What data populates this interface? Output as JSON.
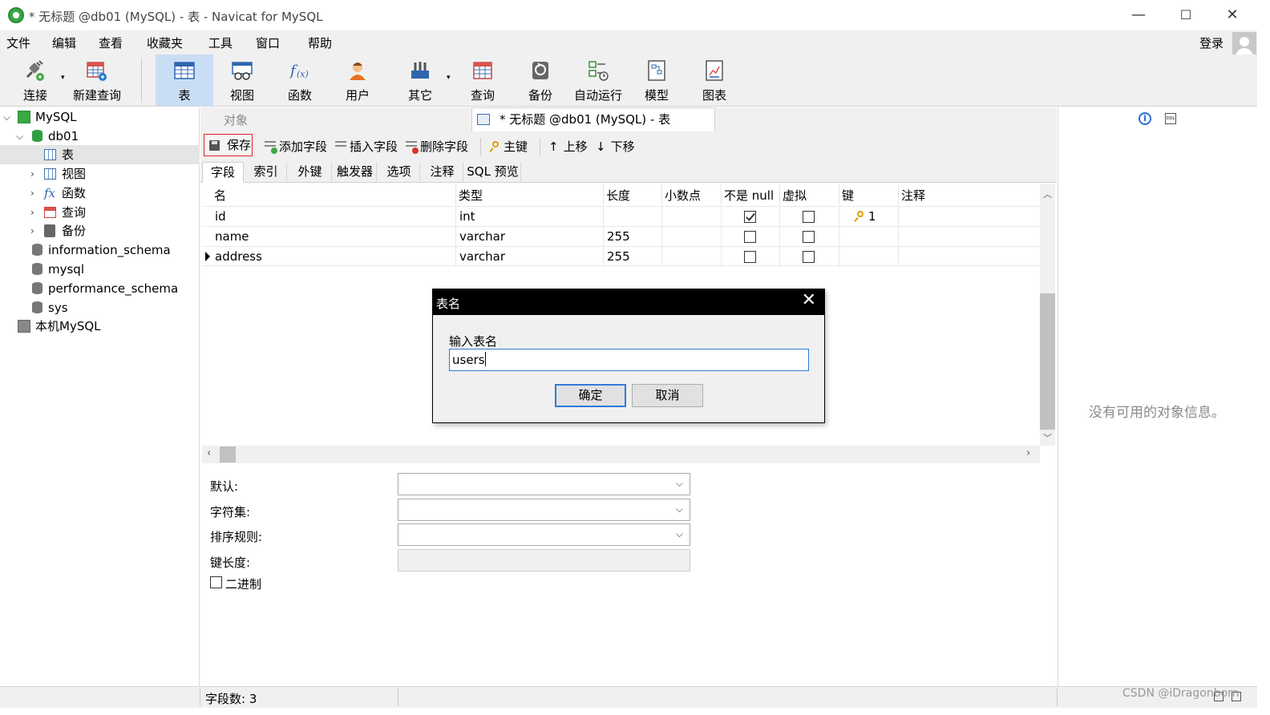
{
  "window": {
    "title": "* 无标题 @db01 (MySQL) - 表 - Navicat for MySQL",
    "controls": [
      "—",
      "☐",
      "✕"
    ]
  },
  "menu": [
    "文件",
    "编辑",
    "查看",
    "收藏夹",
    "工具",
    "窗口",
    "帮助"
  ],
  "login_label": "登录",
  "toolbar": [
    {
      "label": "连接",
      "icon": "plug-icon"
    },
    {
      "label": "新建查询",
      "icon": "new-query-icon"
    },
    {
      "label": "表",
      "icon": "table-icon"
    },
    {
      "label": "视图",
      "icon": "view-icon"
    },
    {
      "label": "函数",
      "icon": "function-icon"
    },
    {
      "label": "用户",
      "icon": "user-icon"
    },
    {
      "label": "其它",
      "icon": "tools-icon"
    },
    {
      "label": "查询",
      "icon": "query-icon"
    },
    {
      "label": "备份",
      "icon": "backup-icon"
    },
    {
      "label": "自动运行",
      "icon": "automation-icon"
    },
    {
      "label": "模型",
      "icon": "model-icon"
    },
    {
      "label": "图表",
      "icon": "chart-icon"
    }
  ],
  "tree": {
    "connection": "MySQL",
    "database": "db01",
    "db_children": [
      "表",
      "视图",
      "函数",
      "查询",
      "备份"
    ],
    "other_dbs": [
      "information_schema",
      "mysql",
      "performance_schema",
      "sys"
    ],
    "local_connection": "本机MySQL"
  },
  "tabs": {
    "objects": "对象",
    "active": "* 无标题 @db01 (MySQL) - 表"
  },
  "editor_toolbar": {
    "save": "保存",
    "add_field": "添加字段",
    "insert_field": "插入字段",
    "delete_field": "删除字段",
    "primary_key": "主键",
    "move_up": "上移",
    "move_down": "下移"
  },
  "subtabs": [
    "字段",
    "索引",
    "外键",
    "触发器",
    "选项",
    "注释",
    "SQL 预览"
  ],
  "grid": {
    "columns": [
      "名",
      "类型",
      "长度",
      "小数点",
      "不是 null",
      "虚拟",
      "键",
      "注释"
    ],
    "rows": [
      {
        "name": "id",
        "type": "int",
        "length": "",
        "decimals": "",
        "not_null": true,
        "virtual": false,
        "key": "1"
      },
      {
        "name": "name",
        "type": "varchar",
        "length": "255",
        "decimals": "",
        "not_null": false,
        "virtual": false,
        "key": ""
      },
      {
        "name": "address",
        "type": "varchar",
        "length": "255",
        "decimals": "",
        "not_null": false,
        "virtual": false,
        "key": ""
      }
    ]
  },
  "properties": {
    "default": "默认:",
    "charset": "字符集:",
    "collation": "排序规则:",
    "key_length": "键长度:",
    "binary": "二进制"
  },
  "info_pane": {
    "empty_text": "没有可用的对象信息。",
    "ddl_icon_text": "DDL"
  },
  "status": {
    "field_count": "字段数: 3",
    "watermark": "CSDN @iDragonborn"
  },
  "dialog": {
    "title": "表名",
    "prompt": "输入表名",
    "value": "users",
    "ok": "确定",
    "cancel": "取消"
  }
}
